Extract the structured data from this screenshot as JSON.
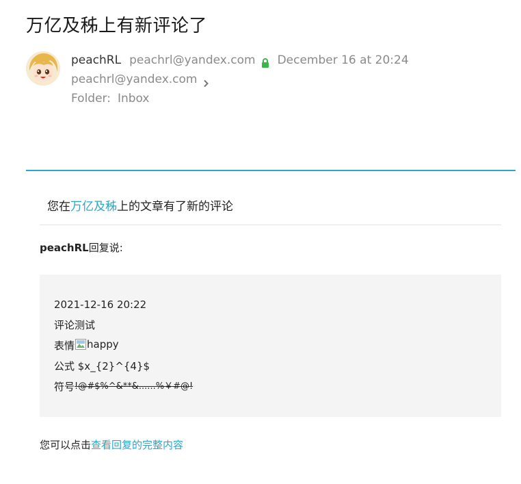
{
  "subject": "万亿及秭上有新评论了",
  "sender": {
    "name": "peachRL",
    "email": "peachrl@yandex.com",
    "date": "December 16 at 20:24"
  },
  "recipient": "peachrl@yandex.com",
  "folder": {
    "label": "Folder:",
    "value": "Inbox"
  },
  "body": {
    "headline_prefix": "您在",
    "headline_link": "万亿及秭",
    "headline_suffix": "上的文章有了新的评论",
    "reply_author": "peachRL",
    "reply_suffix": "回复说:",
    "comment": {
      "timestamp": "2021-12-16 20:22",
      "line1": "评论测试",
      "line2_prefix": "表情",
      "image_alt": "happy",
      "line3": "公式 $x_{2}^{4}$",
      "line4_prefix": "符号 ",
      "line4_strike": "!@#$%^&**&......%￥#@!"
    },
    "footer_prefix": "您可以点击",
    "footer_link": "查看回复的完整内容"
  },
  "colors": {
    "accent": "#2aa7c6",
    "lock": "#3cb54a",
    "muted": "#8a8a8a"
  },
  "icons": [
    "avatar",
    "lock-icon",
    "chevron-right-icon",
    "broken-image-icon"
  ]
}
